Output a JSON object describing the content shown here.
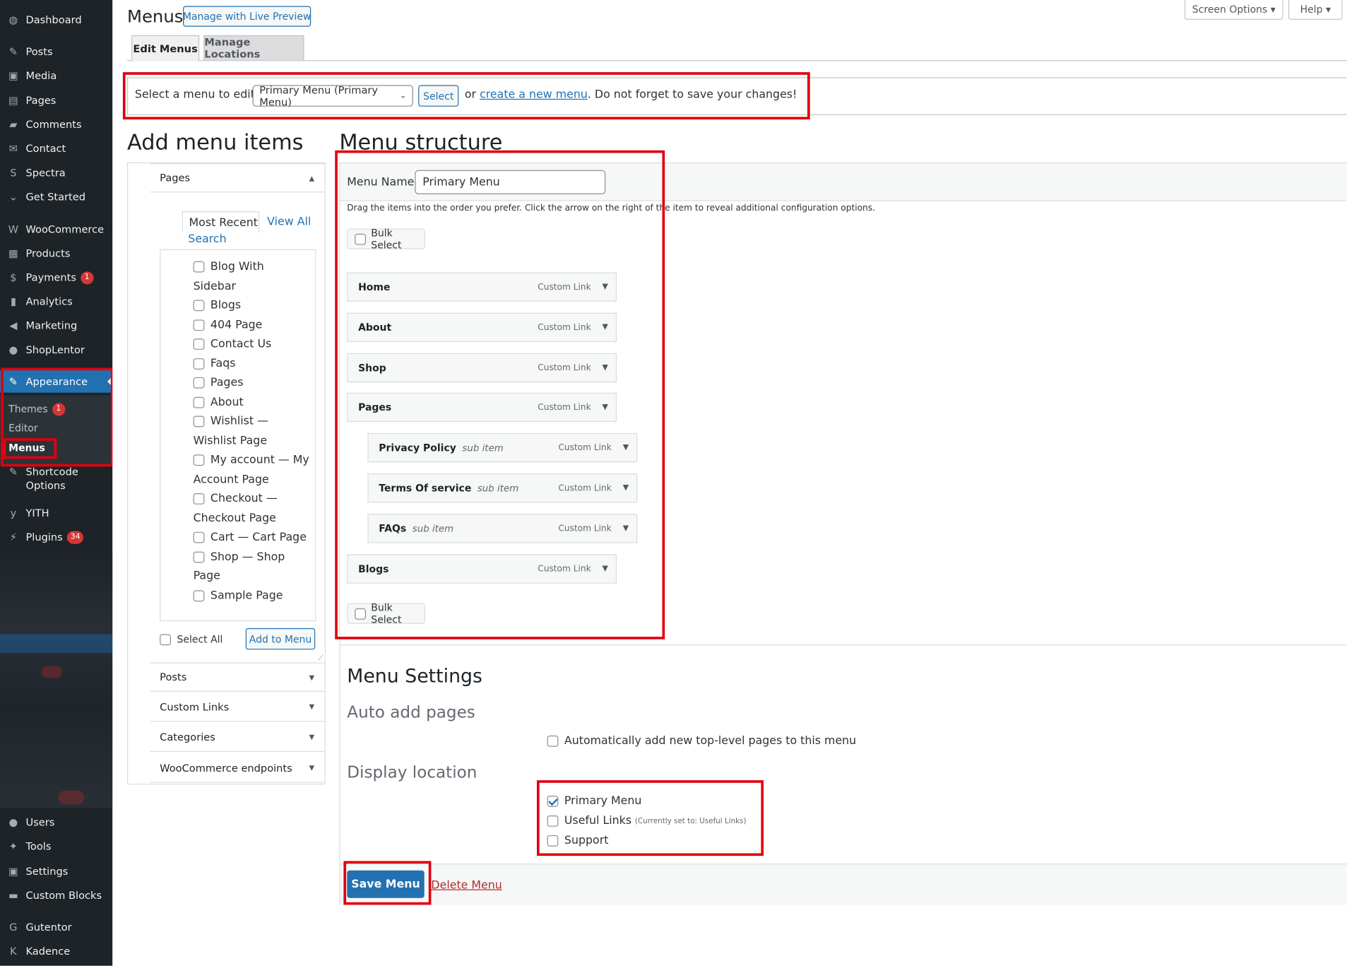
{
  "sidebar": {
    "items": [
      {
        "label": "Dashboard",
        "icon": "dashboard-icon",
        "glyph": "◍"
      },
      {
        "label": "Posts",
        "icon": "pin-icon",
        "glyph": "✎"
      },
      {
        "label": "Media",
        "icon": "media-icon",
        "glyph": "▣"
      },
      {
        "label": "Pages",
        "icon": "pages-icon",
        "glyph": "▤"
      },
      {
        "label": "Comments",
        "icon": "comments-icon",
        "glyph": "▰"
      },
      {
        "label": "Contact",
        "icon": "mail-icon",
        "glyph": "✉"
      },
      {
        "label": "Spectra",
        "icon": "spectra-icon",
        "glyph": "S"
      },
      {
        "label": "Get Started",
        "icon": "chevron-icon",
        "glyph": "⌄"
      },
      {
        "label": "WooCommerce",
        "icon": "woo-icon",
        "glyph": "W"
      },
      {
        "label": "Products",
        "icon": "box-icon",
        "glyph": "▦"
      },
      {
        "label": "Payments",
        "icon": "payments-icon",
        "glyph": "$",
        "badge": "1"
      },
      {
        "label": "Analytics",
        "icon": "chart-icon",
        "glyph": "▮"
      },
      {
        "label": "Marketing",
        "icon": "megaphone-icon",
        "glyph": "◀"
      },
      {
        "label": "ShopLentor",
        "icon": "shoplentor-icon",
        "glyph": "●"
      },
      {
        "label": "Appearance",
        "icon": "brush-icon",
        "glyph": "✎"
      },
      {
        "label": "Shortcode\nOptions",
        "icon": "brush-icon",
        "glyph": "✎"
      },
      {
        "label": "YITH",
        "icon": "yith-icon",
        "glyph": "y"
      },
      {
        "label": "Plugins",
        "icon": "plug-icon",
        "glyph": "⚡",
        "badge": "34"
      },
      {
        "label": "Users",
        "icon": "user-icon",
        "glyph": "●"
      },
      {
        "label": "Tools",
        "icon": "wrench-icon",
        "glyph": "✦"
      },
      {
        "label": "Settings",
        "icon": "settings-icon",
        "glyph": "▣"
      },
      {
        "label": "Custom Blocks",
        "icon": "blocks-icon",
        "glyph": "▬"
      },
      {
        "label": "Gutentor",
        "icon": "gutentor-icon",
        "glyph": "G"
      },
      {
        "label": "Kadence",
        "icon": "kadence-icon",
        "glyph": "K"
      }
    ],
    "submenu": {
      "themes": "Themes",
      "themes_badge": "1",
      "editor": "Editor",
      "menus": "Menus"
    }
  },
  "header": {
    "title": "Menus",
    "live_preview": "Manage with Live Preview",
    "screen_options": "Screen Options ▾",
    "help": "Help ▾",
    "tabs": [
      "Edit Menus",
      "Manage Locations"
    ]
  },
  "select_bar": {
    "label": "Select a menu to edit:",
    "selected": "Primary Menu (Primary Menu)",
    "select_btn": "Select",
    "or": "or",
    "create_link": "create a new menu",
    "tail": ". Do not forget to save your changes!"
  },
  "add_items": {
    "title": "Add menu items",
    "pages_section": "Pages",
    "tabs": {
      "recent": "Most Recent",
      "all": "View All",
      "search": "Search"
    },
    "pages": [
      {
        "a": "Blog With",
        "b": "Sidebar"
      },
      {
        "a": "Blogs"
      },
      {
        "a": "404 Page"
      },
      {
        "a": "Contact Us"
      },
      {
        "a": "Faqs"
      },
      {
        "a": "Pages"
      },
      {
        "a": "About"
      },
      {
        "a": "Wishlist —",
        "b": "Wishlist Page"
      },
      {
        "a": "My account — My",
        "b": "Account Page"
      },
      {
        "a": "Checkout —",
        "b": "Checkout Page"
      },
      {
        "a": "Cart — Cart Page"
      },
      {
        "a": "Shop — Shop",
        "b": "Page"
      },
      {
        "a": "Sample Page"
      }
    ],
    "select_all": "Select All",
    "add_to_menu": "Add to Menu",
    "other_sections": [
      "Posts",
      "Custom Links",
      "Categories",
      "WooCommerce endpoints"
    ]
  },
  "structure": {
    "title": "Menu structure",
    "name_label": "Menu Name",
    "name_value": "Primary Menu",
    "instructions": "Drag the items into the order you prefer. Click the arrow on the right of the item to reveal additional configuration options.",
    "bulk_select": "Bulk Select",
    "items": [
      {
        "title": "Home",
        "type": "Custom Link",
        "sub": ""
      },
      {
        "title": "About",
        "type": "Custom Link",
        "sub": ""
      },
      {
        "title": "Shop",
        "type": "Custom Link",
        "sub": ""
      },
      {
        "title": "Pages",
        "type": "Custom Link",
        "sub": ""
      },
      {
        "title": "Privacy Policy",
        "type": "Custom Link",
        "sub": "sub item"
      },
      {
        "title": "Terms Of service",
        "type": "Custom Link",
        "sub": "sub item"
      },
      {
        "title": "FAQs",
        "type": "Custom Link",
        "sub": "sub item"
      },
      {
        "title": "Blogs",
        "type": "Custom Link",
        "sub": ""
      }
    ]
  },
  "settings": {
    "title": "Menu Settings",
    "auto_add_heading": "Auto add pages",
    "auto_add_label": "Automatically add new top-level pages to this menu",
    "display_heading": "Display location",
    "locations": [
      {
        "label": "Primary Menu",
        "checked": true,
        "note": ""
      },
      {
        "label": "Useful Links",
        "checked": false,
        "note": "(Currently set to: Useful Links)"
      },
      {
        "label": "Support",
        "checked": false,
        "note": ""
      }
    ],
    "save": "Save Menu",
    "delete": "Delete Menu"
  },
  "colors": {
    "accent": "#2271b1",
    "sidebar": "#1d2327",
    "highlight": "#e0000f"
  }
}
